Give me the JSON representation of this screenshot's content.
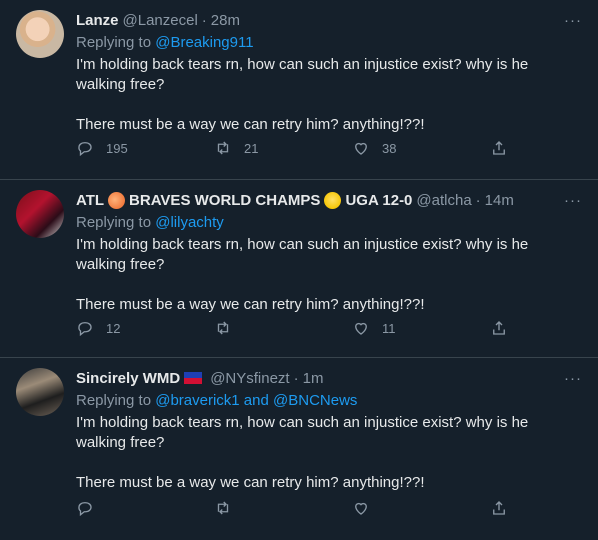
{
  "tweets": [
    {
      "name": "Lanze",
      "handle": "@Lanzecel",
      "time": "28m",
      "reply_prefix": "Replying to",
      "reply_to": "@Breaking911",
      "line1": "I'm holding back tears rn, how can such an injustice exist? why is he walking free?",
      "line2": "There must be a way we can retry him? anything!??!",
      "replies": "195",
      "retweets": "21",
      "likes": "38"
    },
    {
      "name_a": "ATL",
      "name_b": "BRAVES WORLD CHAMPS",
      "name_c": "UGA 12-0",
      "handle": "@atlcha",
      "time": "14m",
      "reply_prefix": "Replying to",
      "reply_to": "@lilyachty",
      "line1": "I'm holding back tears rn, how can such an injustice exist? why is he walking free?",
      "line2": "There must be a way we can retry him? anything!??!",
      "replies": "12",
      "retweets": "",
      "likes": "11"
    },
    {
      "name": "Sincirely WMD",
      "handle": "@NYsfinezt",
      "time": "1m",
      "reply_prefix": "Replying to",
      "reply_to": "@braverick1 and @BNCNews",
      "line1": "I'm holding back tears rn, how can such an injustice exist? why is he walking free?",
      "line2": "There must be a way we can retry him? anything!??!",
      "replies": "",
      "retweets": "",
      "likes": ""
    }
  ],
  "icons": {
    "reply": "reply-icon",
    "retweet": "retweet-icon",
    "like": "heart-icon",
    "share": "share-icon",
    "more": "more-icon"
  },
  "colors": {
    "background": "#15202b",
    "link": "#1d9bf0",
    "muted": "#8b98a5"
  },
  "more_glyph": "···",
  "dot": "·"
}
